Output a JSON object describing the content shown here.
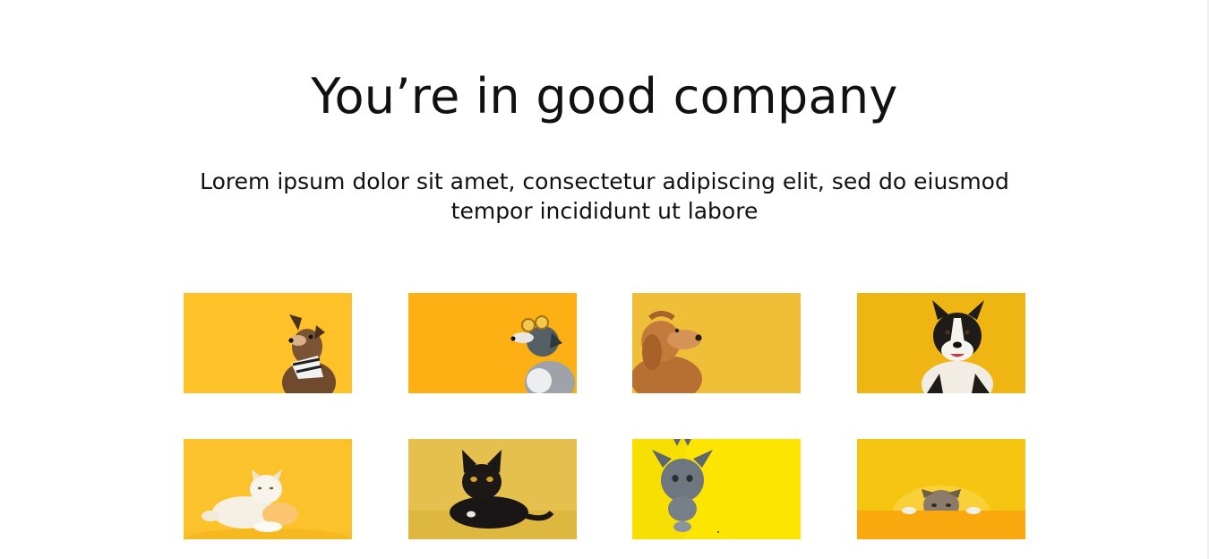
{
  "header": {
    "title": "You’re in good company",
    "subtitle": "Lorem ipsum dolor sit amet, consectetur adipiscing elit, sed do eiusmod tempor incididunt ut labore"
  },
  "gallery": {
    "tiles": [
      {
        "subject": "dog-with-bandana",
        "background": "#fec127"
      },
      {
        "subject": "dog-with-sunglasses",
        "background": "#fdb013"
      },
      {
        "subject": "curly-brown-dog",
        "background": "#eebf37"
      },
      {
        "subject": "border-collie",
        "background": "#efb512"
      },
      {
        "subject": "white-fluffy-cat",
        "background": "#fbc22c"
      },
      {
        "subject": "black-cat",
        "background": "#e5c04f"
      },
      {
        "subject": "grey-kitten",
        "background": "#fde502"
      },
      {
        "subject": "peeking-tabby-cat",
        "background": "#f6c511"
      }
    ]
  }
}
